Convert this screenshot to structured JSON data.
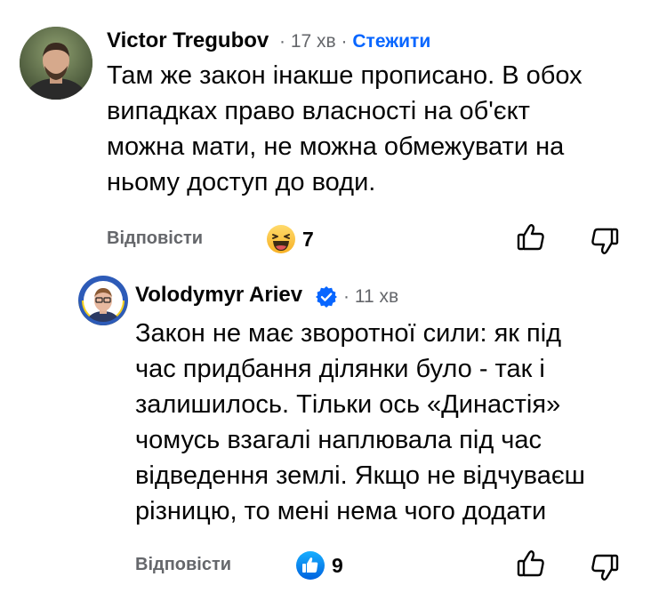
{
  "comment1": {
    "author": "Victor Tregubov",
    "time": "17 хв",
    "follow_label": "Стежити",
    "lines": [
      "Там же закон інакше прописано. В обох",
      "випадках право власності на об'єкт",
      "можна мати, не можна обмежувати на",
      "ньому доступ до води."
    ],
    "reply_label": "Відповісти",
    "reaction_icon": "haha-emoji-icon",
    "reaction_count": "7"
  },
  "comment2": {
    "author": "Volodymyr Ariev",
    "verified_icon": "verified-badge-icon",
    "time": "11 хв",
    "lines": [
      "Закон не має зворотної сили: як під",
      "час придбання ділянки було - так і",
      "залишилось. Тільки ось «Династія»",
      "чомусь взагалі наплювала під час",
      "відведення землі. Якщо не відчуваєш",
      "різницю, то мені нема чого додати"
    ],
    "reply_label": "Відповісти",
    "reaction_icon": "like-icon",
    "reaction_count": "9"
  },
  "separator": "·",
  "colors": {
    "link": "#0866ff",
    "secondary": "#65676b",
    "text": "#050505"
  }
}
